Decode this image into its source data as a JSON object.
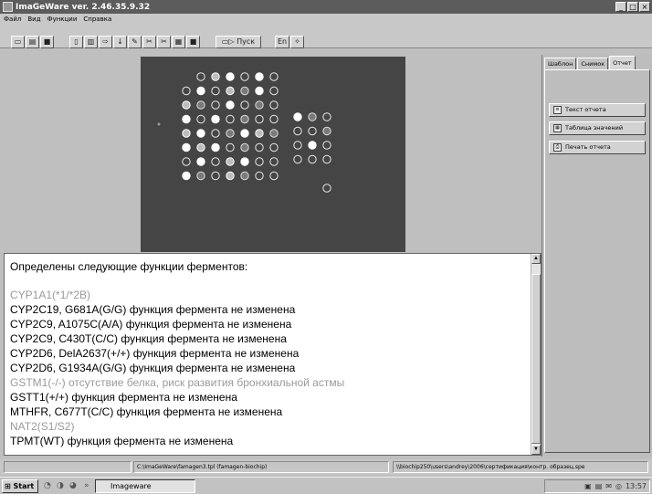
{
  "window": {
    "title": "ImaGeWare ver. 2.46.35.9.32"
  },
  "menu": [
    "Файл",
    "Вид",
    "Функции",
    "Справка"
  ],
  "toolbar": {
    "run_label": "Пуск",
    "lang_label": "En"
  },
  "right_panel": {
    "tabs": [
      "Шаблон",
      "Снимок",
      "Отчет"
    ],
    "active_tab": 2,
    "buttons": [
      "Текст отчета",
      "Таблица значений",
      "Печать отчета"
    ]
  },
  "results": {
    "lines": [
      {
        "text": "Определены следующие функции ферментов:",
        "muted": false
      },
      {
        "text": "CYP1A1(*1/*2B)",
        "muted": true
      },
      {
        "text": "CYP2C19, G681A(G/G) функция фермента не изменена",
        "muted": false
      },
      {
        "text": "CYP2C9, A1075C(A/A) функция фермента не изменена",
        "muted": false
      },
      {
        "text": "CYP2C9, C430T(C/C) функция фермента не изменена",
        "muted": false
      },
      {
        "text": "CYP2D6, DelA2637(+/+) функция фермента не изменена",
        "muted": false
      },
      {
        "text": "CYP2D6, G1934A(G/G) функция фермента не изменена",
        "muted": false
      },
      {
        "text": "GSTM1(-/-) отсутствие белка, риск развития бронхиальной астмы",
        "muted": true
      },
      {
        "text": "GSTT1(+/+) функция фермента не изменена",
        "muted": false
      },
      {
        "text": "MTHFR, C677T(C/C) функция фермента не изменена",
        "muted": false
      },
      {
        "text": "NAT2(S1/S2)",
        "muted": true
      },
      {
        "text": "TPMT(WT) функция фермента не изменена",
        "muted": false
      }
    ]
  },
  "status": {
    "template_path": "C:\\ImaGeWare\\famagen3.tpl (famagen-biochip)",
    "image_path": "\\\\biochip250\\users\\andrey\\2006\\сертификация\\контр. образец.spe"
  },
  "taskbar": {
    "start_label": "Start",
    "task_label": "Imageware",
    "clock": "13:57"
  },
  "colors": {
    "muted_text": "#9a9a9a",
    "titlebar": "#5c5c5c",
    "image_bg": "#454545"
  }
}
